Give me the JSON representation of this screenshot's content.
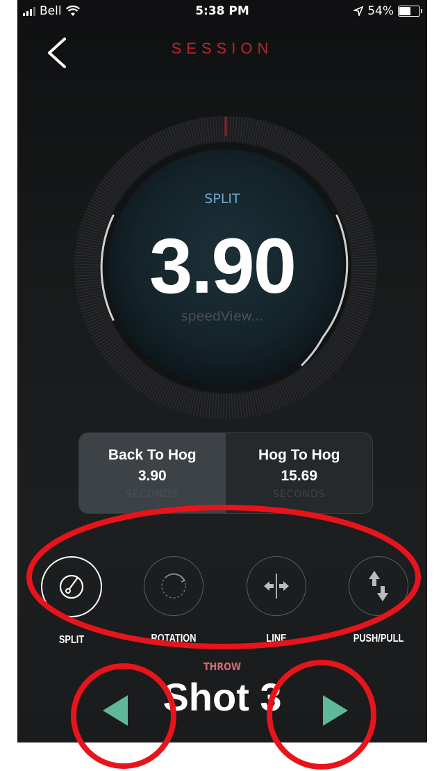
{
  "status_bar": {
    "carrier": "Bell",
    "time": "5:38 PM",
    "battery": "54%",
    "battery_level": 0.54
  },
  "header": {
    "title": "SESSION"
  },
  "gauge": {
    "label": "SPLIT",
    "value": "3.90",
    "sublabel": "speedView..."
  },
  "cards": [
    {
      "title": "Back To Hog",
      "value": "3.90",
      "unit": "SECONDS"
    },
    {
      "title": "Hog To Hog",
      "value": "15.69",
      "unit": "SECONDS"
    }
  ],
  "modes": [
    {
      "label": "SPLIT",
      "icon": "stopwatch-icon"
    },
    {
      "label": "ROTATION",
      "icon": "rotation-icon"
    },
    {
      "label": "LINE",
      "icon": "line-icon"
    },
    {
      "label": "PUSH/PULL",
      "icon": "push-pull-icon"
    }
  ],
  "footer": {
    "category": "THROW",
    "shot": "Shot 3"
  },
  "colors": {
    "title": "#b6272c",
    "accent_blue": "#6fa7c8",
    "arrow": "#5fb89a",
    "annotation": "#e8141b",
    "throw": "#d66a70"
  }
}
